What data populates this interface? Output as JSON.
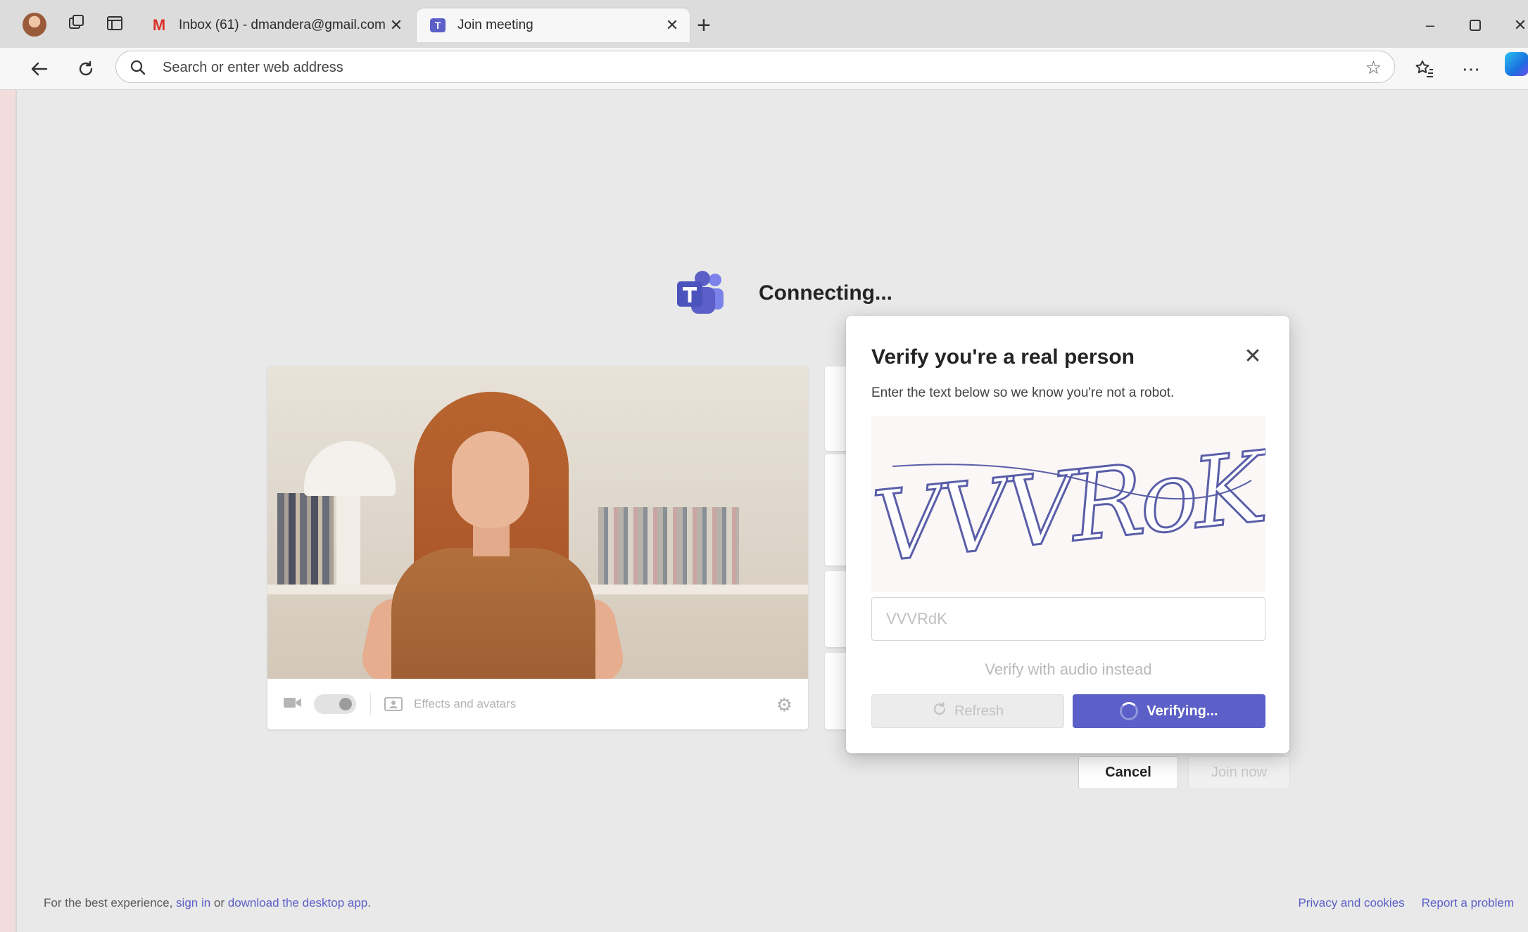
{
  "browser": {
    "tabs": [
      {
        "title": "Inbox (61) - dmandera@gmail.com",
        "favicon": "gmail-icon",
        "active": false
      },
      {
        "title": "Join meeting",
        "favicon": "teams-icon",
        "active": true
      }
    ],
    "tab_close_glyph": "✕",
    "new_tab_glyph": "+",
    "address_placeholder": "Search or enter web address"
  },
  "page": {
    "status_text": "Connecting...",
    "preview": {
      "effects_label": "Effects and avatars"
    },
    "cancel_label": "Cancel",
    "join_label": "Join now"
  },
  "dialog": {
    "title": "Verify you're a real person",
    "subtitle": "Enter the text below so we know you're not a robot.",
    "captcha_text": "VVVRoK",
    "input_value": "VVVRdK",
    "audio_link": "Verify with audio instead",
    "refresh_label": "Refresh",
    "verify_label": "Verifying..."
  },
  "footer": {
    "prefix": "For the best experience, ",
    "sign_in": "sign in",
    "middle": " or ",
    "download": "download the desktop app",
    "suffix": ".",
    "privacy": "Privacy and cookies",
    "report": "Report a problem"
  },
  "colors": {
    "teams_purple": "#5b5fc7",
    "captcha_ink": "#5a5ea8"
  }
}
